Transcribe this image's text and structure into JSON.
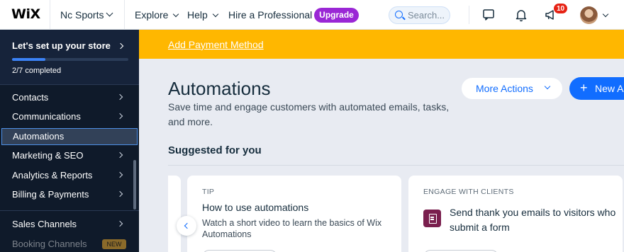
{
  "topbar": {
    "logo": "WiX",
    "site_name": "Nc Sports",
    "nav": {
      "explore": "Explore",
      "help": "Help",
      "hire": "Hire a Professional"
    },
    "upgrade_label": "Upgrade",
    "search_placeholder": "Search...",
    "notifications_badge": "10"
  },
  "sidebar": {
    "setup_title": "Let's set up your store",
    "setup_progress_text": "2/7 completed",
    "setup_progress_fraction": 0.2857,
    "items": [
      {
        "label": "Contacts",
        "has_arrow": true
      },
      {
        "label": "Communications",
        "has_arrow": true
      },
      {
        "label": "Automations",
        "active": true
      },
      {
        "label": "Marketing & SEO",
        "has_arrow": true
      },
      {
        "label": "Analytics & Reports",
        "has_arrow": true
      },
      {
        "label": "Billing & Payments",
        "has_arrow": true
      },
      {
        "label": "Sales Channels",
        "has_arrow": true
      },
      {
        "label": "Booking Channels",
        "tag": "NEW"
      }
    ]
  },
  "banner": {
    "link": "Add Payment Method"
  },
  "main": {
    "title": "Automations",
    "subtitle": "Save time and engage customers with automated emails, tasks, and more.",
    "more_actions_label": "More Actions",
    "new_label": "New A",
    "section_title": "Suggested for you",
    "cards": [
      {
        "kicker": "TIP",
        "title": "How to use automations",
        "description": "Watch a short video to learn the basics of Wix Automations"
      },
      {
        "kicker": "ENGAGE WITH CLIENTS",
        "title": "Send thank you emails to visitors who submit a form"
      }
    ]
  },
  "colors": {
    "accent": "#116dff",
    "banner": "#ffb700",
    "sidebar": "#0f1a2a",
    "upgrade": "#9a27d5",
    "badge": "#e62214"
  }
}
